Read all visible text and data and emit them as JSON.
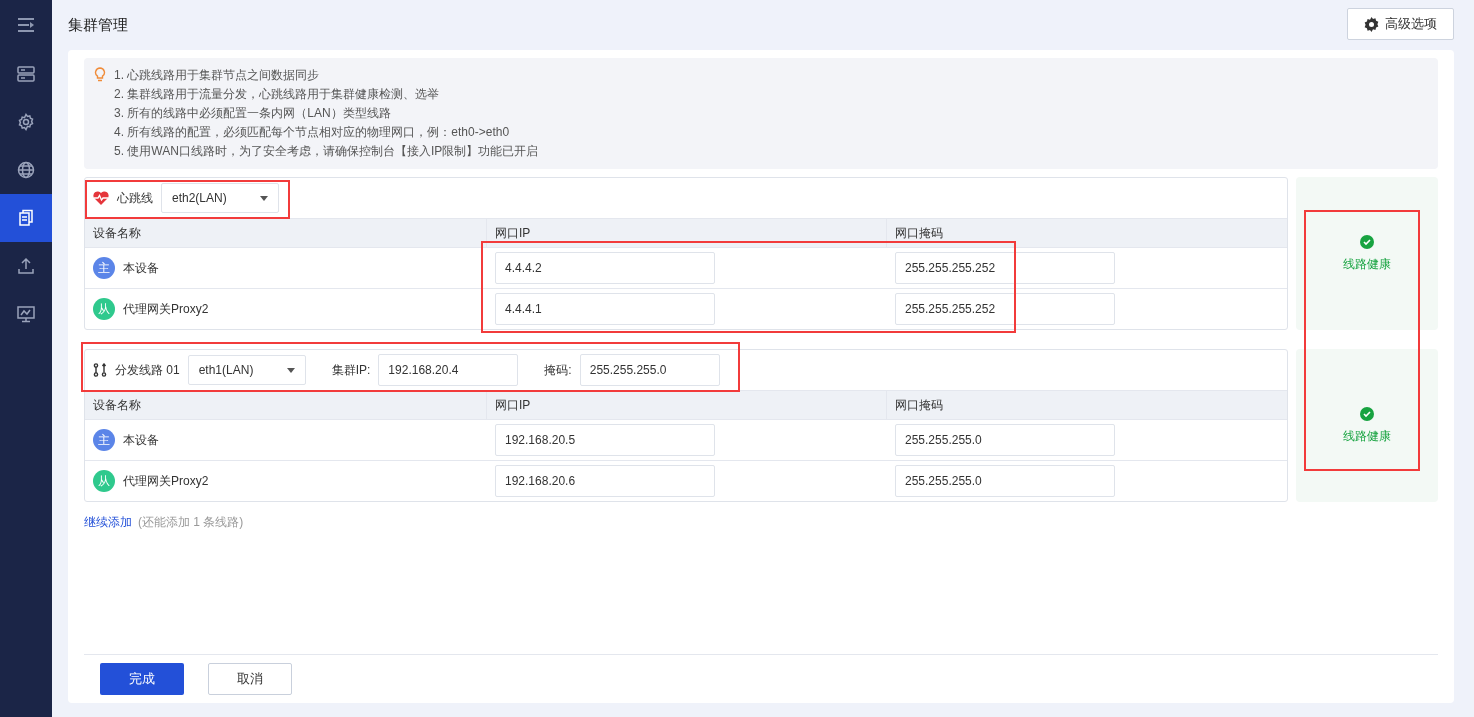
{
  "sidebar": {
    "items": [
      {
        "selected": false
      },
      {
        "selected": false
      },
      {
        "selected": false
      },
      {
        "selected": true
      },
      {
        "selected": false
      },
      {
        "selected": false
      }
    ]
  },
  "page_title": "集群管理",
  "advanced_button": "高级选项",
  "tips": [
    "1. 心跳线路用于集群节点之间数据同步",
    "2. 集群线路用于流量分发，心跳线路用于集群健康检测、选举",
    "3. 所有的线路中必须配置一条内网（LAN）类型线路",
    "4. 所有线路的配置，必须匹配每个节点相对应的物理网口，例：eth0->eth0",
    "5. 使用WAN口线路时，为了安全考虑，请确保控制台【接入IP限制】功能已开启"
  ],
  "lines": [
    {
      "kind": "heartbeat",
      "label": "心跳线",
      "interface": "eth2(LAN)",
      "columns": [
        "设备名称",
        "网口IP",
        "网口掩码"
      ],
      "rows": [
        {
          "badge": "主",
          "color": "#5b85e8",
          "name": "本设备",
          "ip": "4.4.4.2",
          "mask": "255.255.255.252"
        },
        {
          "badge": "从",
          "color": "#2fc98d",
          "name": "代理网关Proxy2",
          "ip": "4.4.4.1",
          "mask": "255.255.255.252"
        }
      ],
      "status": "线路健康"
    },
    {
      "kind": "distribution",
      "label": "分发线路 01",
      "interface": "eth1(LAN)",
      "cluster_ip_label": "集群IP:",
      "cluster_ip": "192.168.20.4",
      "mask_label": "掩码:",
      "mask": "255.255.255.0",
      "columns": [
        "设备名称",
        "网口IP",
        "网口掩码"
      ],
      "rows": [
        {
          "badge": "主",
          "color": "#5b85e8",
          "name": "本设备",
          "ip": "192.168.20.5",
          "mask": "255.255.255.0"
        },
        {
          "badge": "从",
          "color": "#2fc98d",
          "name": "代理网关Proxy2",
          "ip": "192.168.20.6",
          "mask": "255.255.255.0"
        }
      ],
      "status": "线路健康"
    }
  ],
  "add_link": "继续添加",
  "add_hint": "(还能添加 1 条线路)",
  "footer_buttons": [
    {
      "kind": "primary",
      "label": "完成"
    },
    {
      "kind": "default",
      "label": "取消"
    }
  ]
}
